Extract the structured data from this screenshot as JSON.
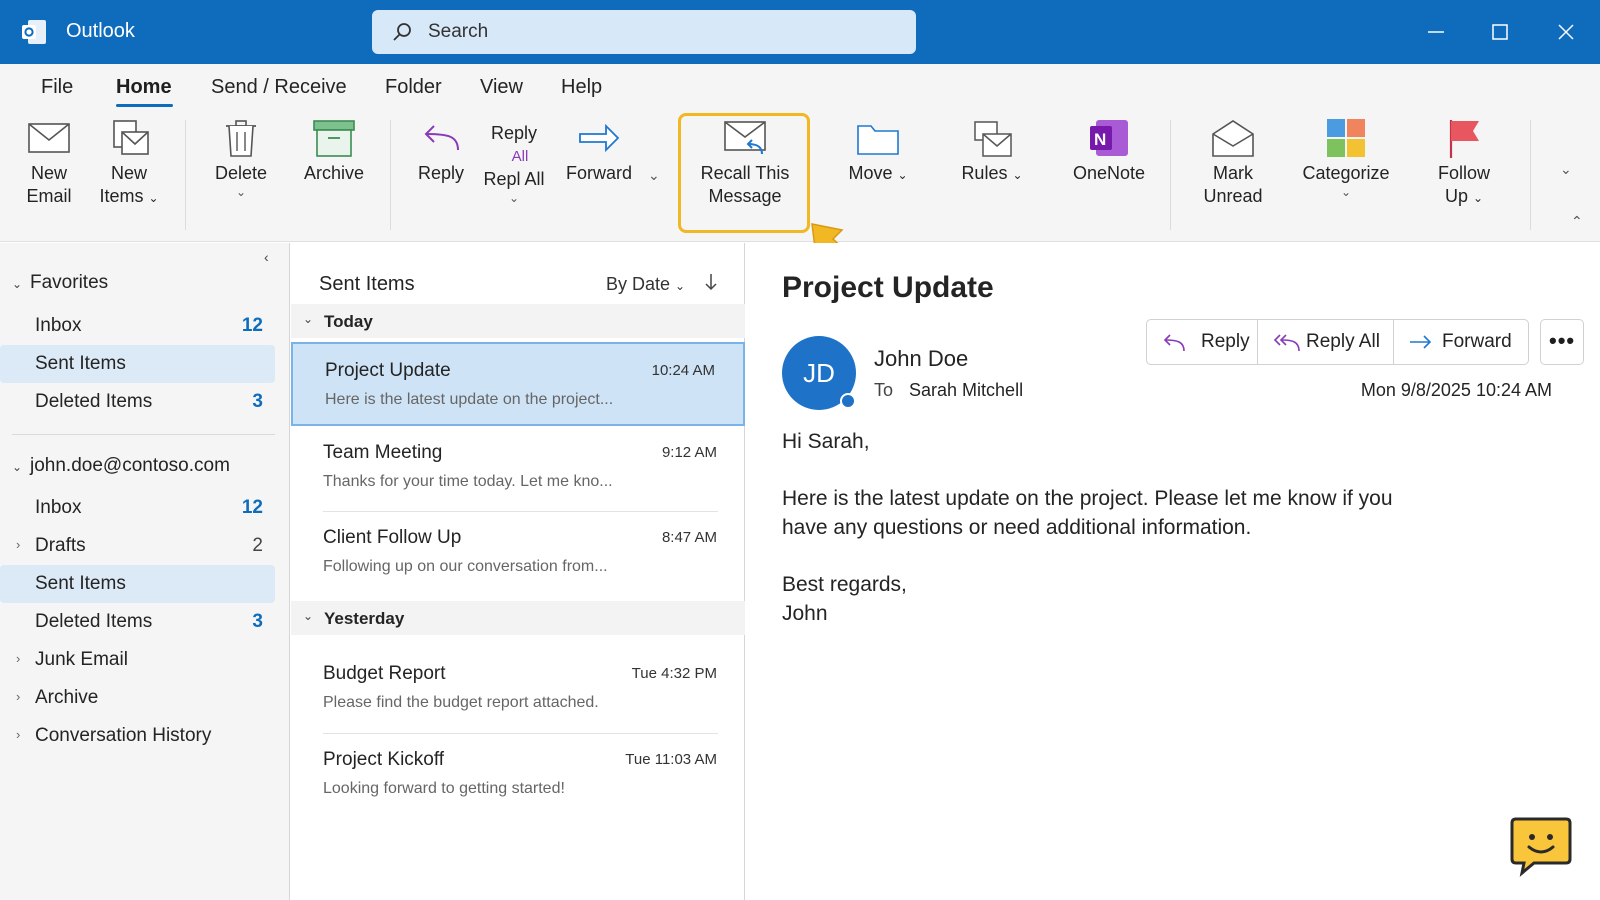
{
  "app": {
    "name": "Outlook"
  },
  "search": {
    "placeholder": "Search"
  },
  "menu": {
    "tabs": [
      "File",
      "Home",
      "Send / Receive",
      "Folder",
      "View",
      "Help"
    ],
    "active": "Home"
  },
  "ribbon": {
    "new_email": [
      "New",
      "Email"
    ],
    "new_items": [
      "New",
      "Items"
    ],
    "delete": "Delete",
    "archive": "Archive",
    "reply": "Reply",
    "reply_all": [
      "Reply",
      "All",
      "Repl All"
    ],
    "forward": "Forward",
    "recall": [
      "Recall This",
      "Message"
    ],
    "move": "Move",
    "rules": "Rules",
    "onenote": "OneNote",
    "mark_unread": [
      "Mark",
      "Unread"
    ],
    "categorize": "Categorize",
    "follow_up": [
      "Follow",
      "Up"
    ]
  },
  "folders": {
    "favorites_label": "Favorites",
    "favorites": [
      {
        "name": "Inbox",
        "count": "12"
      },
      {
        "name": "Sent Items",
        "count": ""
      },
      {
        "name": "Deleted Items",
        "count": "3"
      }
    ],
    "account_label": "john.doe@contoso.com",
    "account": [
      {
        "name": "Inbox",
        "count": "12"
      },
      {
        "name": "Drafts",
        "count": "2"
      },
      {
        "name": "Sent Items",
        "count": ""
      },
      {
        "name": "Deleted Items",
        "count": "3"
      },
      {
        "name": "Junk Email",
        "count": ""
      },
      {
        "name": "Archive",
        "count": ""
      },
      {
        "name": "Conversation History",
        "count": ""
      }
    ]
  },
  "message_list": {
    "title": "Sent Items",
    "sort": "By Date",
    "groups": [
      "Today",
      "Yesterday"
    ],
    "messages": [
      {
        "subject": "Project Update",
        "time": "10:24 AM",
        "preview": "Here is the latest update on the project..."
      },
      {
        "subject": "Team Meeting",
        "time": "9:12 AM",
        "preview": "Thanks for your time today. Let me kno..."
      },
      {
        "subject": "Client Follow Up",
        "time": "8:47 AM",
        "preview": "Following up on our conversation from..."
      },
      {
        "subject": "Budget Report",
        "time": "Tue 4:32 PM",
        "preview": "Please find the budget report attached."
      },
      {
        "subject": "Project Kickoff",
        "time": "Tue 11:03 AM",
        "preview": "Looking forward to getting started!"
      }
    ]
  },
  "reading": {
    "subject": "Project Update",
    "initials": "JD",
    "sender": "John Doe",
    "to_label": "To",
    "recipient": "Sarah Mitchell",
    "date": "Mon 9/8/2025 10:24 AM",
    "actions": {
      "reply": "Reply",
      "reply_all": "Reply All",
      "forward": "Forward"
    },
    "more": "•••",
    "body": {
      "greeting": "Hi Sarah,",
      "line1": "Here is the latest update on the project. Please let me know if you",
      "line2": "have any questions or need additional information.",
      "closing": "Best regards,",
      "signature": "John"
    }
  },
  "colors": {
    "brand": "#0f6cbd",
    "highlight": "#f2b824",
    "selected": "#cfe3f6"
  }
}
